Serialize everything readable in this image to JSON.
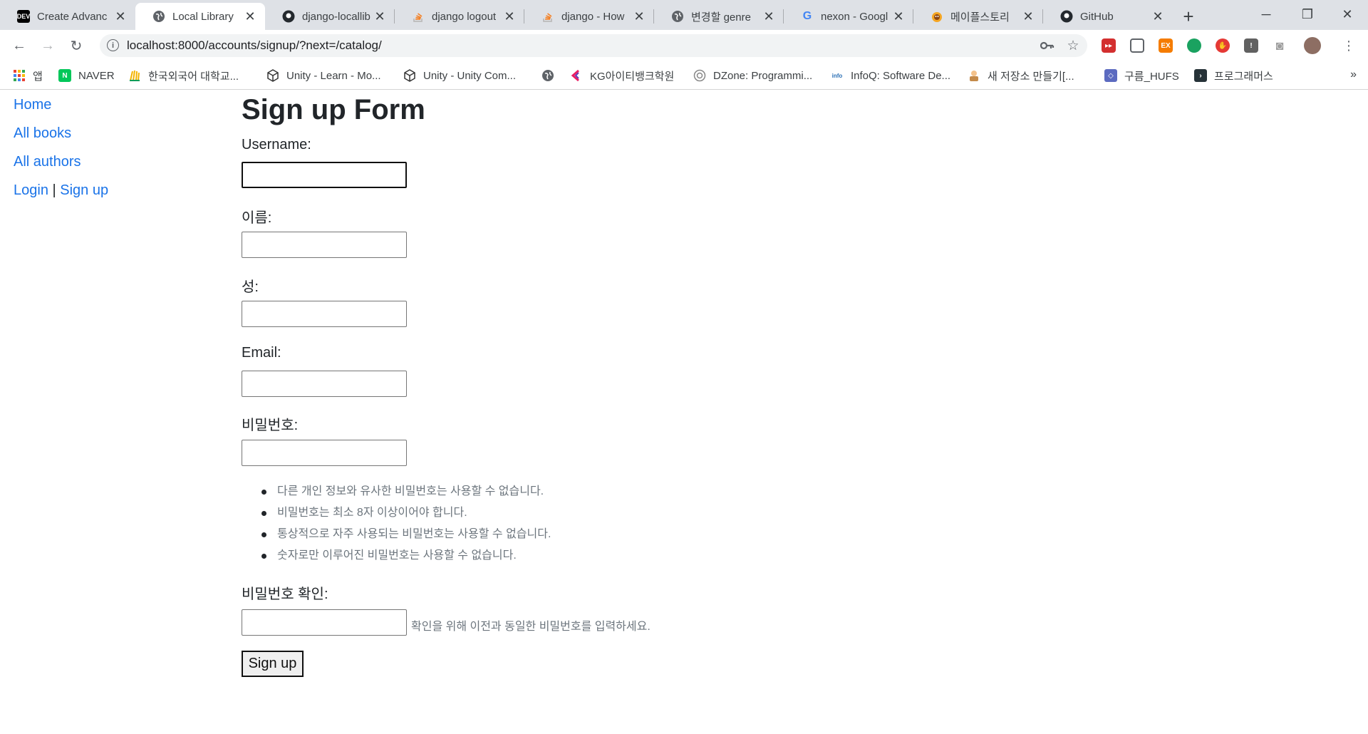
{
  "browser": {
    "tabs": [
      {
        "title": "Create Advanc",
        "icon": "dev-logo-icon",
        "favtext": "DEV",
        "active": false
      },
      {
        "title": "Local Library",
        "icon": "globe-icon",
        "favtext": "",
        "active": true
      },
      {
        "title": "django-locallib",
        "icon": "github-icon",
        "favtext": "",
        "active": false
      },
      {
        "title": "django logout",
        "icon": "stackoverflow-icon",
        "favtext": "",
        "active": false
      },
      {
        "title": "django - How",
        "icon": "stackoverflow-icon",
        "favtext": "",
        "active": false
      },
      {
        "title": "변경할 genre",
        "icon": "globe-icon",
        "favtext": "",
        "active": false
      },
      {
        "title": "nexon - Googl",
        "icon": "google-icon",
        "favtext": "G",
        "active": false
      },
      {
        "title": "메이플스토리",
        "icon": "maplestory-icon",
        "favtext": "",
        "active": false
      },
      {
        "title": "GitHub",
        "icon": "github-icon",
        "favtext": "",
        "active": false
      }
    ],
    "url": "localhost:8000/accounts/signup/?next=/catalog/",
    "bookmarks": [
      {
        "label": "앱",
        "icon": "apps-grid-icon"
      },
      {
        "label": "NAVER",
        "icon": "naver-icon"
      },
      {
        "label": "한국외국어 대학교...",
        "icon": "hufs-icon"
      },
      {
        "label": "Unity - Learn - Mo...",
        "icon": "unity-icon"
      },
      {
        "label": "Unity - Unity Com...",
        "icon": "unity-icon"
      },
      {
        "label": "",
        "icon": "globe-icon"
      },
      {
        "label": "KG아이티뱅크학원",
        "icon": "kg-icon"
      },
      {
        "label": "DZone: Programmi...",
        "icon": "dzone-icon"
      },
      {
        "label": "InfoQ: Software De...",
        "icon": "infoq-icon"
      },
      {
        "label": "새 저장소 만들기[...",
        "icon": "repo-icon"
      },
      {
        "label": "구름_HUFS",
        "icon": "goorm-icon"
      },
      {
        "label": "프로그래머스",
        "icon": "programmers-icon"
      }
    ]
  },
  "sidebar": {
    "home": "Home",
    "all_books": "All books",
    "all_authors": "All authors",
    "login": "Login",
    "separator": "|",
    "signup": "Sign up"
  },
  "form": {
    "title": "Sign up Form",
    "username_label": "Username:",
    "first_name_label": "이름:",
    "last_name_label": "성:",
    "email_label": "Email:",
    "password_label": "비밀번호:",
    "password_help": [
      "다른 개인 정보와 유사한 비밀번호는 사용할 수 없습니다.",
      "비밀번호는 최소 8자 이상이어야 합니다.",
      "통상적으로 자주 사용되는 비밀번호는 사용할 수 없습니다.",
      "숫자로만 이루어진 비밀번호는 사용할 수 없습니다."
    ],
    "password_confirm_label": "비밀번호 확인:",
    "password_confirm_help": "확인을 위해 이전과 동일한 비밀번호를 입력하세요.",
    "submit_label": "Sign up"
  },
  "colors": {
    "link": "#1a73e8",
    "tabstrip": "#dee1e6",
    "help_text": "#6c757d"
  }
}
